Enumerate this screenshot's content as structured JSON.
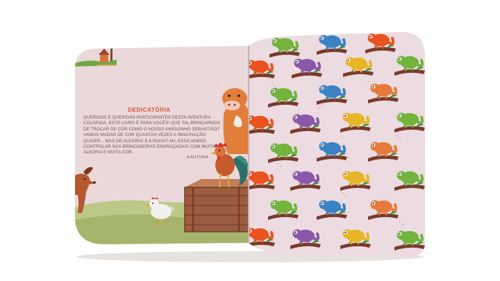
{
  "book": {
    "dedication": {
      "title": "DEDICATÓRIA",
      "body": "Queridos e queridas participantes desta aventura colorida, este livro é para vocês! Que tal brincarmos de trocar de cor como o nosso amiguinho Sebastião? Vamos mudar de cor quantas vezes a imaginação quiser... Mas de alegria! E a raiva? Ah, essa vamos controlar nas brincadeiras engraçadas! Com muita alegria e muita cor,",
      "signature": "A AUTORA"
    },
    "illustrations": [
      "house",
      "dog",
      "cow",
      "rooster",
      "chicken",
      "wooden-crate",
      "chameleon-pattern"
    ],
    "pattern_colors": [
      "#e8531f",
      "#8a58a8",
      "#3b82c4",
      "#e6b627",
      "#72b43c",
      "#e57a3a"
    ]
  }
}
